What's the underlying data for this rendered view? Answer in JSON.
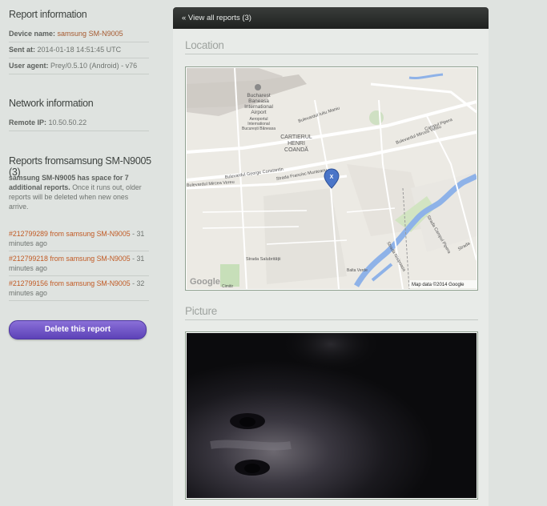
{
  "sidebar": {
    "report_info_title": "Report information",
    "device_label": "Device name:",
    "device_value": "samsung SM-N9005",
    "sent_label": "Sent at:",
    "sent_value": "2014-01-18 14:51:45 UTC",
    "agent_label": "User agent:",
    "agent_value": "Prey/0.5.10 (Android) - v76",
    "network_title": "Network information",
    "ip_label": "Remote IP:",
    "ip_value": "10.50.50.22",
    "reports_title": "Reports fromsamsung SM-N9005 (3)",
    "space_bold": "samsung SM-N9005 has space for 7 additional reports.",
    "space_rest": " Once it runs out, older reports will be deleted when new ones arrive.",
    "reports": [
      {
        "id": "#212799289",
        "from": "from samsung SM-N9005",
        "when": "31 minutes ago"
      },
      {
        "id": "#212799218",
        "from": "from samsung SM-N9005",
        "when": "31 minutes ago"
      },
      {
        "id": "#212799156",
        "from": "from samsung SM-N9005",
        "when": "32 minutes ago"
      }
    ],
    "delete_label": "Delete this report"
  },
  "main": {
    "view_all": "« View all reports (3)",
    "location_title": "Location",
    "picture_title": "Picture",
    "map": {
      "airport": [
        "Bucharest",
        "Baneasa",
        "International",
        "Airport"
      ],
      "aeroport": [
        "Aeroportul",
        "International",
        "București Băneasa"
      ],
      "cartier": [
        "CARTIERUL",
        "HENRI",
        "COANDĂ"
      ],
      "streets": {
        "iuliu": "Bulevardul Iuliu Maniu",
        "mircea1": "Bulevardul Mircea Vereu",
        "pipera": "Campul Pipera",
        "george": "Bulevardul George Constantin",
        "francisc": "Strada Francisc Munteanu",
        "mircea2": "Bulevardul Mircea Vereu",
        "salubritatii": "Strada Salubrității",
        "nisipoasa": "Strada Nisipoasa",
        "campul": "Strada Campul Pipera",
        "strada": "Strada",
        "balta": "Balta Verde",
        "cimitir": "Cimitir"
      },
      "marker": "X",
      "google": "Google",
      "mapdata": "Map data ©2014 Google"
    }
  },
  "colors": {
    "accent": "#c15a24",
    "button": "#6a4fc6",
    "topbar": "#2b2e2c"
  }
}
